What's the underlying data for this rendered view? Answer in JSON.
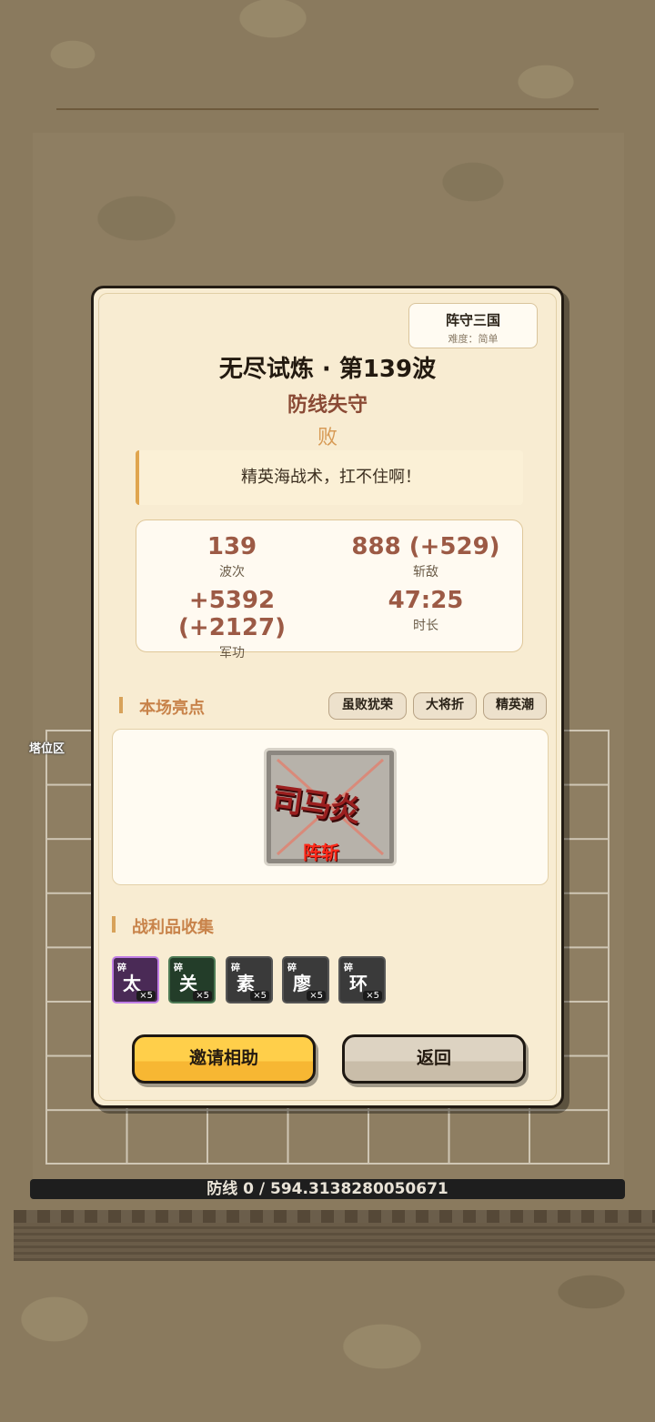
{
  "background": {
    "tower_area_label": "塔位区",
    "defense_bar": "防线 0 / 594.3138280050671"
  },
  "modal": {
    "badge": {
      "title": "阵守三国",
      "difficulty": "难度：简单"
    },
    "title": "无尽试炼 · 第139波",
    "subtitle": "防线失守",
    "result": "败",
    "quote": "精英海战术，扛不住啊！",
    "stats": [
      {
        "value": "139",
        "label": "波次"
      },
      {
        "value": "888 (+529)",
        "label": "斩敌"
      },
      {
        "value": "+5392 (+2127)",
        "label": "军功"
      },
      {
        "value": "47:25",
        "label": "时长"
      }
    ],
    "highlights": {
      "title": "本场亮点",
      "tags": [
        "虽败犹荣",
        "大将折",
        "精英潮"
      ],
      "card": {
        "name": "司马炎",
        "status": "阵斩"
      }
    },
    "loot": {
      "title": "战利品收集",
      "items": [
        {
          "tag": "碎",
          "name": "太",
          "count": "×5",
          "color": "#4a2a56",
          "border": "#c07ee6"
        },
        {
          "tag": "碎",
          "name": "关",
          "count": "×5",
          "color": "#233d29",
          "border": "#4d7a55"
        },
        {
          "tag": "碎",
          "name": "素",
          "count": "×5",
          "color": "#3a3a3a",
          "border": "#555555"
        },
        {
          "tag": "碎",
          "name": "廖",
          "count": "×5",
          "color": "#3a3a3a",
          "border": "#555555"
        },
        {
          "tag": "碎",
          "name": "环",
          "count": "×5",
          "color": "#3a3a3a",
          "border": "#555555"
        }
      ]
    },
    "buttons": {
      "invite": "邀请相助",
      "back": "返回"
    },
    "colors": {
      "invite_button": "#f7b733",
      "back_button": "#c9bda9",
      "accent": "#9c5a45"
    }
  }
}
